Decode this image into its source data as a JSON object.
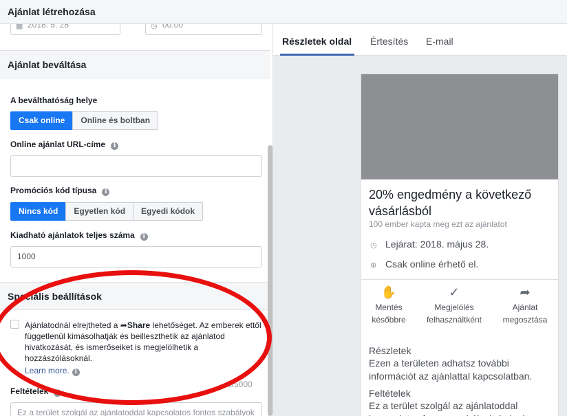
{
  "header": {
    "title": "Ajánlat létrehozása"
  },
  "dates": {
    "date_value": "2018. 5. 28",
    "time_value": "00:00"
  },
  "redemption": {
    "section_title": "Ajánlat beváltása",
    "place_label": "A beválthatóság helye",
    "place_options": [
      "Csak online",
      "Online és boltban"
    ],
    "url_label": "Online ajánlat URL-címe",
    "url_value": "",
    "promo_label": "Promóciós kód típusa",
    "promo_options": [
      "Nincs kód",
      "Egyetlen kód",
      "Egyedi kódok"
    ],
    "total_label": "Kiadható ajánlatok teljes száma",
    "total_value": "1000"
  },
  "special": {
    "section_title": "Speciális beállítások",
    "text_before": "Ajánlatodnál elrejtheted a ",
    "share_word": "Share",
    "text_after": " lehetőséget. Az emberek ettől függetlenül kimásolhatják és beilleszthetik az ajánlatod hivatkozását, és ismerőseiket is megjelölhetik a hozzászólásoknál.",
    "learn_more": "Learn more.",
    "counter": "0/5000",
    "terms_label": "Feltételek",
    "terms_placeholder": "Ez a terület szolgál az ajánlatoddal kapcsolatos fontos szabályok"
  },
  "preview": {
    "tabs": [
      "Részletek oldal",
      "Értesítés",
      "E-mail"
    ],
    "headline": "20% engedmény a következő vásárlásból",
    "claimed": "100 ember kapta meg ezt az ajánlatot",
    "expiry": "Lejárat: 2018. május 28.",
    "availability": "Csak online érhető el.",
    "actions": [
      {
        "label_line1": "Mentés",
        "label_line2": "későbbre",
        "icon": "save-hand-icon"
      },
      {
        "label_line1": "Megjelölés",
        "label_line2": "felhasználtként",
        "icon": "checkmark-icon"
      },
      {
        "label_line1": "Ajánlat",
        "label_line2": "megosztása",
        "icon": "share-arrow-icon"
      }
    ],
    "details_title": "Részletek",
    "details_body": "Ezen a területen adhatsz további információt az ajánlattal kapcsolatban.",
    "terms_title": "Feltételek",
    "terms_body": "Ez a terület szolgál az ajánlatoddal kapcsolatos fontos szabályok és jogi"
  },
  "colors": {
    "accent": "#1877f2",
    "annotation": "#e8100e",
    "link": "#365899"
  }
}
